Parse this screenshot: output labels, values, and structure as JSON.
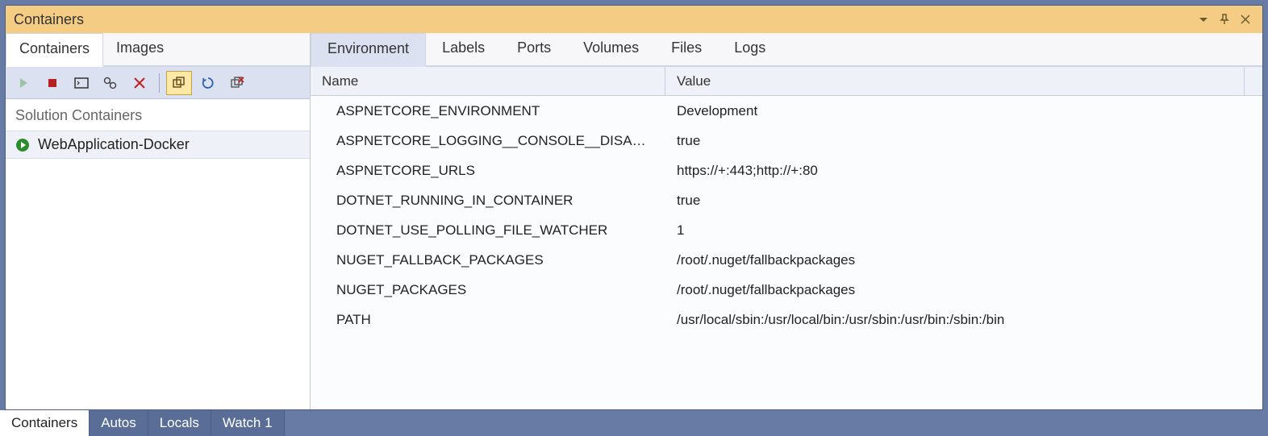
{
  "titlebar": {
    "title": "Containers"
  },
  "leftTabs": {
    "containers": "Containers",
    "images": "Images"
  },
  "toolbarIcons": {
    "play": "play-icon",
    "stop": "stop-icon",
    "terminal": "terminal-icon",
    "settings": "settings-icon",
    "delete": "delete-icon",
    "copy": "copy-icon",
    "refresh": "refresh-icon",
    "prune": "prune-icon"
  },
  "groupHeader": "Solution Containers",
  "containerItem": {
    "name": "WebApplication-Docker"
  },
  "rightTabs": {
    "environment": "Environment",
    "labels": "Labels",
    "ports": "Ports",
    "volumes": "Volumes",
    "files": "Files",
    "logs": "Logs"
  },
  "columns": {
    "name": "Name",
    "value": "Value"
  },
  "rows": [
    {
      "name": "ASPNETCORE_ENVIRONMENT",
      "value": "Development"
    },
    {
      "name": "ASPNETCORE_LOGGING__CONSOLE__DISA…",
      "value": "true"
    },
    {
      "name": "ASPNETCORE_URLS",
      "value": "https://+:443;http://+:80"
    },
    {
      "name": "DOTNET_RUNNING_IN_CONTAINER",
      "value": "true"
    },
    {
      "name": "DOTNET_USE_POLLING_FILE_WATCHER",
      "value": "1"
    },
    {
      "name": "NUGET_FALLBACK_PACKAGES",
      "value": "/root/.nuget/fallbackpackages"
    },
    {
      "name": "NUGET_PACKAGES",
      "value": "/root/.nuget/fallbackpackages"
    },
    {
      "name": "PATH",
      "value": "/usr/local/sbin:/usr/local/bin:/usr/sbin:/usr/bin:/sbin:/bin"
    }
  ],
  "bottomTabs": {
    "containers": "Containers",
    "autos": "Autos",
    "locals": "Locals",
    "watch1": "Watch 1"
  }
}
